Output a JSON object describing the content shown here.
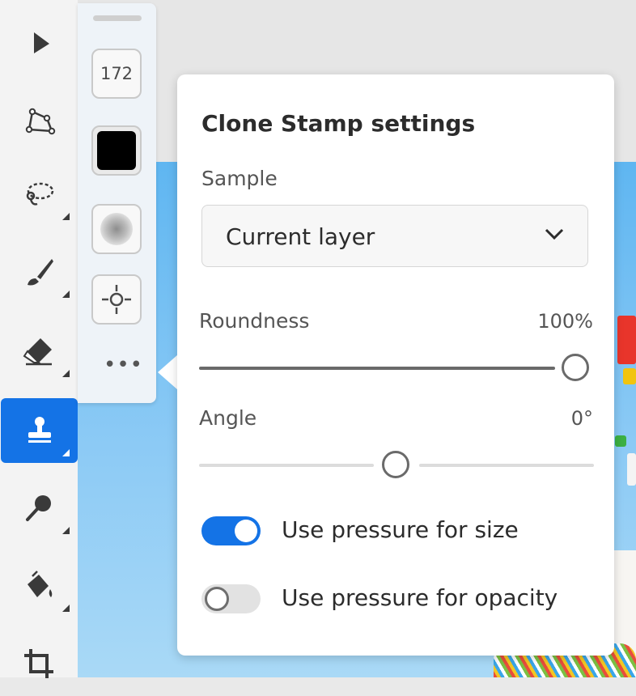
{
  "toolbar": {
    "tools": [
      {
        "name": "select-tool",
        "icon": "arrow-pointer-icon",
        "has_flyout": false
      },
      {
        "name": "transform-tool",
        "icon": "polygon-transform-icon",
        "has_flyout": false
      },
      {
        "name": "lasso-tool",
        "icon": "lasso-icon",
        "has_flyout": true
      },
      {
        "name": "brush-tool",
        "icon": "brush-icon",
        "has_flyout": true
      },
      {
        "name": "eraser-tool",
        "icon": "eraser-icon",
        "has_flyout": true
      },
      {
        "name": "clone-stamp-tool",
        "icon": "clone-stamp-icon",
        "has_flyout": true,
        "active": true
      },
      {
        "name": "healing-tool",
        "icon": "spot-healing-icon",
        "has_flyout": true
      },
      {
        "name": "fill-tool",
        "icon": "paint-bucket-icon",
        "has_flyout": true
      },
      {
        "name": "crop-tool",
        "icon": "crop-icon",
        "has_flyout": false
      }
    ],
    "active_color": "#1473e6"
  },
  "rail": {
    "brush_size": "172",
    "color_swatch": "#000000",
    "softness_icon": "brush-softness-icon",
    "sample_point_icon": "crosshair-icon",
    "more_label": "•••"
  },
  "popover": {
    "title": "Clone Stamp settings",
    "sample_label": "Sample",
    "sample_value": "Current layer",
    "roundness_label": "Roundness",
    "roundness_value": "100%",
    "roundness_fraction": 1.0,
    "angle_label": "Angle",
    "angle_value": "0°",
    "angle_fraction": 0.5,
    "pressure_size_label": "Use pressure for size",
    "pressure_size_on": true,
    "pressure_opacity_label": "Use pressure for opacity",
    "pressure_opacity_on": false
  }
}
